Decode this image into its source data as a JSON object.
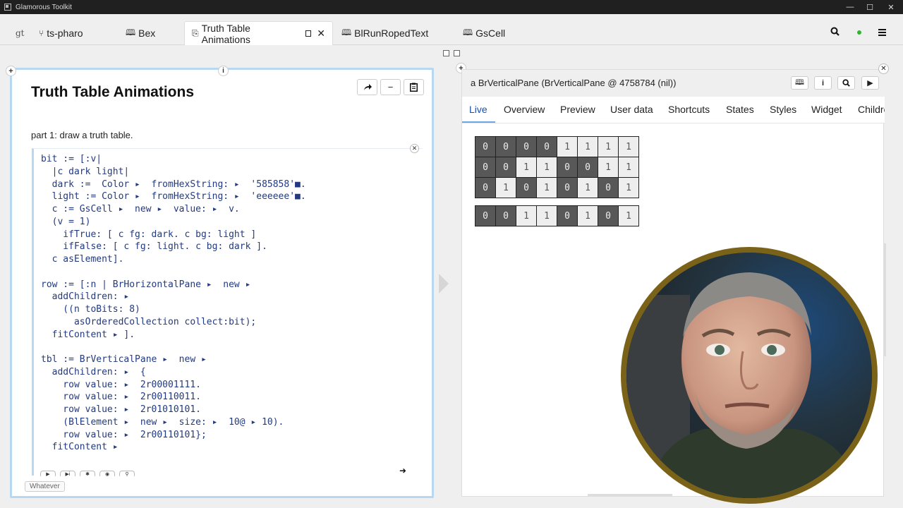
{
  "window": {
    "title": "Glamorous Toolkit",
    "controls": [
      "—",
      "☐",
      "✕"
    ]
  },
  "tabs": [
    {
      "label": "gt",
      "glyph": ""
    },
    {
      "label": "ts-pharo",
      "glyph": "⑂"
    },
    {
      "label": "Bex",
      "glyph": "🕮"
    },
    {
      "label": "Truth Table Animations",
      "glyph": "⎘",
      "active": true
    },
    {
      "label": "BlRunRopedText",
      "glyph": "🕮"
    },
    {
      "label": "GsCell",
      "glyph": "🕮"
    }
  ],
  "toolbar": {
    "search_icon": "search-icon",
    "status_color": "#2db52d",
    "menu_icon": "menu-icon"
  },
  "left_pane": {
    "title": "Truth Table Animations",
    "intro": "part 1: draw a truth table.",
    "footer_label": "Whatever",
    "code_lines": [
      "bit := [:v|",
      "  |c dark light|",
      "  dark :=  Color ▸  fromHexString: ▸  '585858'■.",
      "  light := Color ▸  fromHexString: ▸  'eeeeee'■.",
      "  c := GsCell ▸  new ▸  value: ▸  v.",
      "  (v = 1)",
      "    ifTrue: [ c fg: dark. c bg: light ]",
      "    ifFalse: [ c fg: light. c bg: dark ].",
      "  c asElement].",
      "",
      "row := [:n | BrHorizontalPane ▸  new ▸",
      "  addChildren: ▸",
      "    ((n toBits: 8)",
      "      asOrderedCollection collect:bit);",
      "  fitContent ▸ ].",
      "",
      "tbl := BrVerticalPane ▸  new ▸",
      "  addChildren: ▸  {",
      "    row value: ▸  2r00001111.",
      "    row value: ▸  2r00110011.",
      "    row value: ▸  2r01010101.",
      "    (BlElement ▸  new ▸  size: ▸  10@ ▸ 10).",
      "    row value: ▸  2r00110101};",
      "  fitContent ▸"
    ]
  },
  "right_pane": {
    "title": "a BrVerticalPane (BrVerticalPane @ 4758784 (nil))",
    "tabs": [
      "Live",
      "Overview",
      "Preview",
      "User data",
      "Shortcuts",
      "States",
      "Styles",
      "Widget",
      "Children"
    ],
    "active_tab": "Live",
    "colors": {
      "dark": "#585858",
      "light": "#eeeeee"
    },
    "table_rows": [
      [
        "0",
        "0",
        "0",
        "0",
        "1",
        "1",
        "1",
        "1"
      ],
      [
        "0",
        "0",
        "1",
        "1",
        "0",
        "0",
        "1",
        "1"
      ],
      [
        "0",
        "1",
        "0",
        "1",
        "0",
        "1",
        "0",
        "1"
      ],
      [
        "0",
        "0",
        "1",
        "1",
        "0",
        "1",
        "0",
        "1"
      ]
    ]
  }
}
